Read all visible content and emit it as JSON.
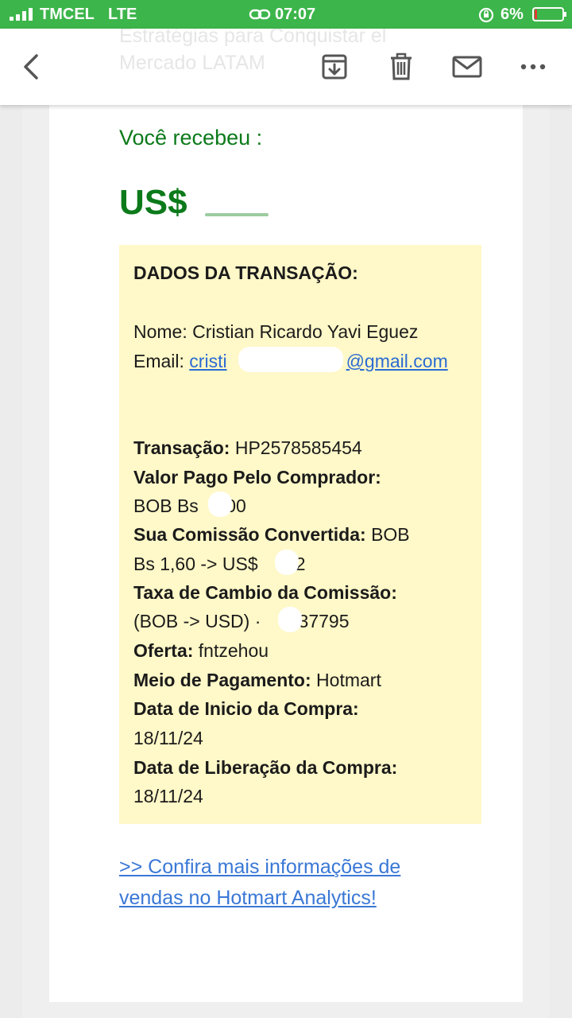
{
  "status_bar": {
    "carrier": "TMCEL",
    "network": "LTE",
    "time": "07:07",
    "battery": "6%",
    "icons": [
      "signal-icon",
      "link-icon",
      "rotation-lock-icon",
      "battery-icon"
    ]
  },
  "toolbar": {
    "subject_line1": "Estratégias para Conquistar el",
    "subject_line2": "Mercado LATAM",
    "icons": [
      "back-icon",
      "archive-icon",
      "delete-icon",
      "mail-icon",
      "more-icon"
    ]
  },
  "email": {
    "received_label": "Você recebeu :",
    "amount_prefix": "US$",
    "transaction": {
      "heading": "DADOS DA TRANSAÇÃO:",
      "name_label": "Nome:",
      "name_value": "Cristian Ricardo Yavi Eguez",
      "email_label": "Email:",
      "email_start": "cristi",
      "email_end": "@gmail.com",
      "tx_label": "Transação:",
      "tx_value": "HP2578585454",
      "paid_label": "Valor Pago Pelo Comprador:",
      "paid_value_start": "BOB Bs",
      "paid_value_end": ",00",
      "commission_label": "Sua Comissão Convertida:",
      "commission_value_a": "BOB",
      "commission_value_b": "Bs 1,60 -> US$",
      "commission_value_c": ".22",
      "rate_label": "Taxa de Cambio da Comissão:",
      "rate_value_start": "(BOB -> USD) ·",
      "rate_value_end": ",137795",
      "offer_label": "Oferta:",
      "offer_value": "fntzehou",
      "payment_label": "Meio de Pagamento:",
      "payment_value": "Hotmart",
      "start_date_label": "Data de Inicio da Compra:",
      "start_date_value": "18/11/24",
      "release_date_label": "Data de Liberação da Compra:",
      "release_date_value": "18/11/24"
    },
    "cta_line1": ">> Confira mais informações de",
    "cta_line2": "vendas no Hotmart Analytics!"
  },
  "colors": {
    "status_bar": "#3cb54a",
    "accent_green": "#0c7a1a",
    "box_bg": "#fff8c8",
    "link": "#3a78d6"
  }
}
